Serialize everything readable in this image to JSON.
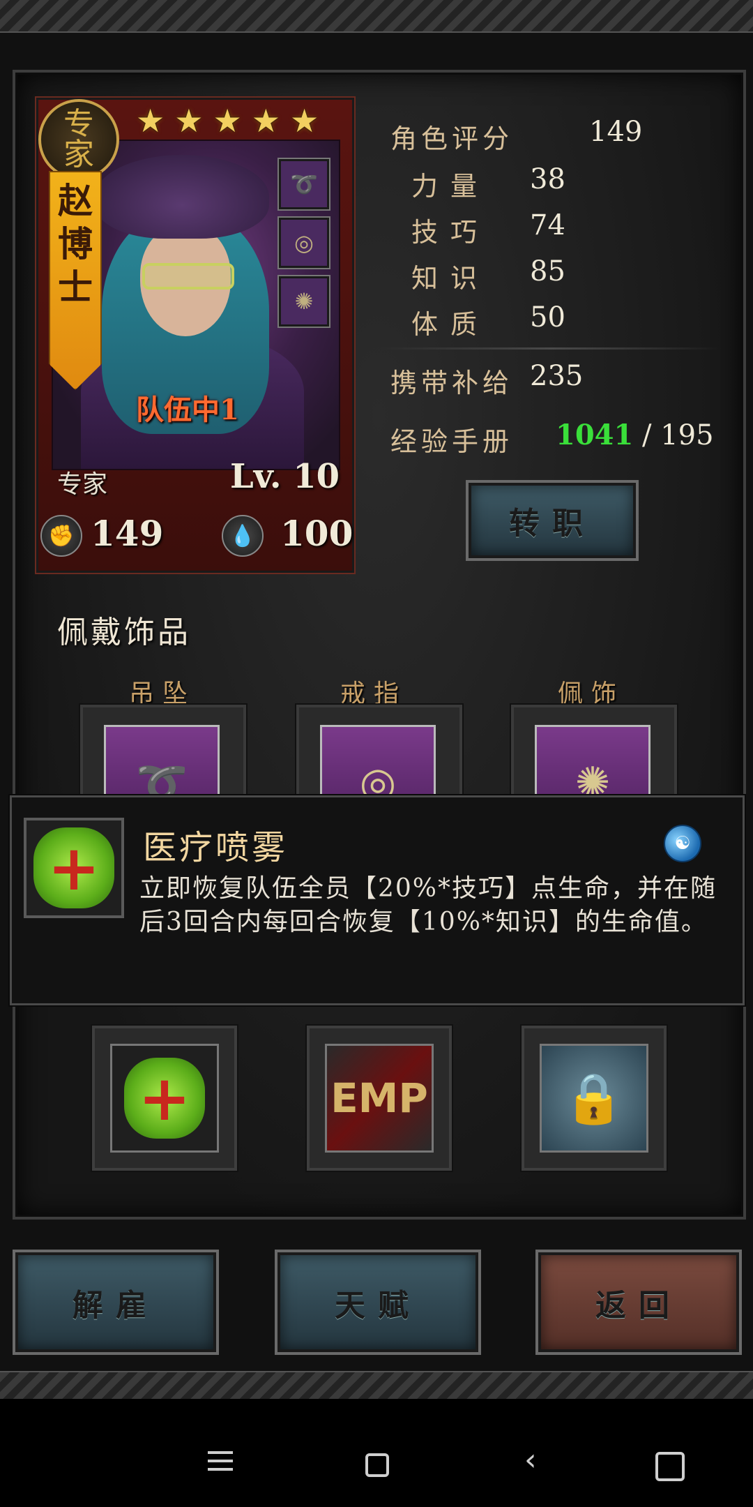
{
  "character": {
    "rank_badge": "专家",
    "name_chars": [
      "赵",
      "博",
      "士"
    ],
    "stars": 5,
    "team_status": "队伍中1",
    "class_name": "专家",
    "level_text": "Lv. 10",
    "power": "149",
    "energy": "100",
    "equip_icons": [
      "pendant-icon",
      "ring-icon",
      "trinket-icon"
    ]
  },
  "stats": {
    "rating_label": "角色评分",
    "rating_value": "149",
    "strength_label": "力量",
    "strength_value": "38",
    "skill_label": "技巧",
    "skill_value": "74",
    "knowledge_label": "知识",
    "knowledge_value": "85",
    "constitution_label": "体质",
    "constitution_value": "50",
    "supplies_label": "携带补给",
    "supplies_value": "235",
    "xp_label": "经验手册",
    "xp_current": "1041",
    "xp_separator": " / ",
    "xp_required": "195"
  },
  "buttons": {
    "transfer": "转职",
    "dismiss": "解雇",
    "talent": "天赋",
    "back": "返回"
  },
  "accessories": {
    "header": "佩戴饰品",
    "slots": [
      "吊坠",
      "戒指",
      "佩饰"
    ]
  },
  "tooltip": {
    "title": "医疗喷雾",
    "description": "立即恢复队伍全员【20%*技巧】点生命，并在随后3回合内每回合恢复【10%*知识】的生命值。",
    "icon": "medkit-icon",
    "type_icon": "yin-yang-icon"
  },
  "skills": [
    {
      "name": "medical-spray",
      "icon": "medkit-icon"
    },
    {
      "name": "emp",
      "label": "EMP",
      "icon": "emp-icon"
    },
    {
      "name": "locked",
      "icon": "lock-icon"
    }
  ],
  "system_nav": {
    "menu_icon": "menu-icon",
    "home_icon": "home-icon",
    "back_icon": "back-icon",
    "recents_icon": "recents-icon"
  },
  "colors": {
    "xp_current": "#3adf3a",
    "team_status": "#ff6a30",
    "button_blue": "#3e5a66",
    "button_red": "#7a4a3e",
    "banner_gold": "#f2b21a"
  }
}
